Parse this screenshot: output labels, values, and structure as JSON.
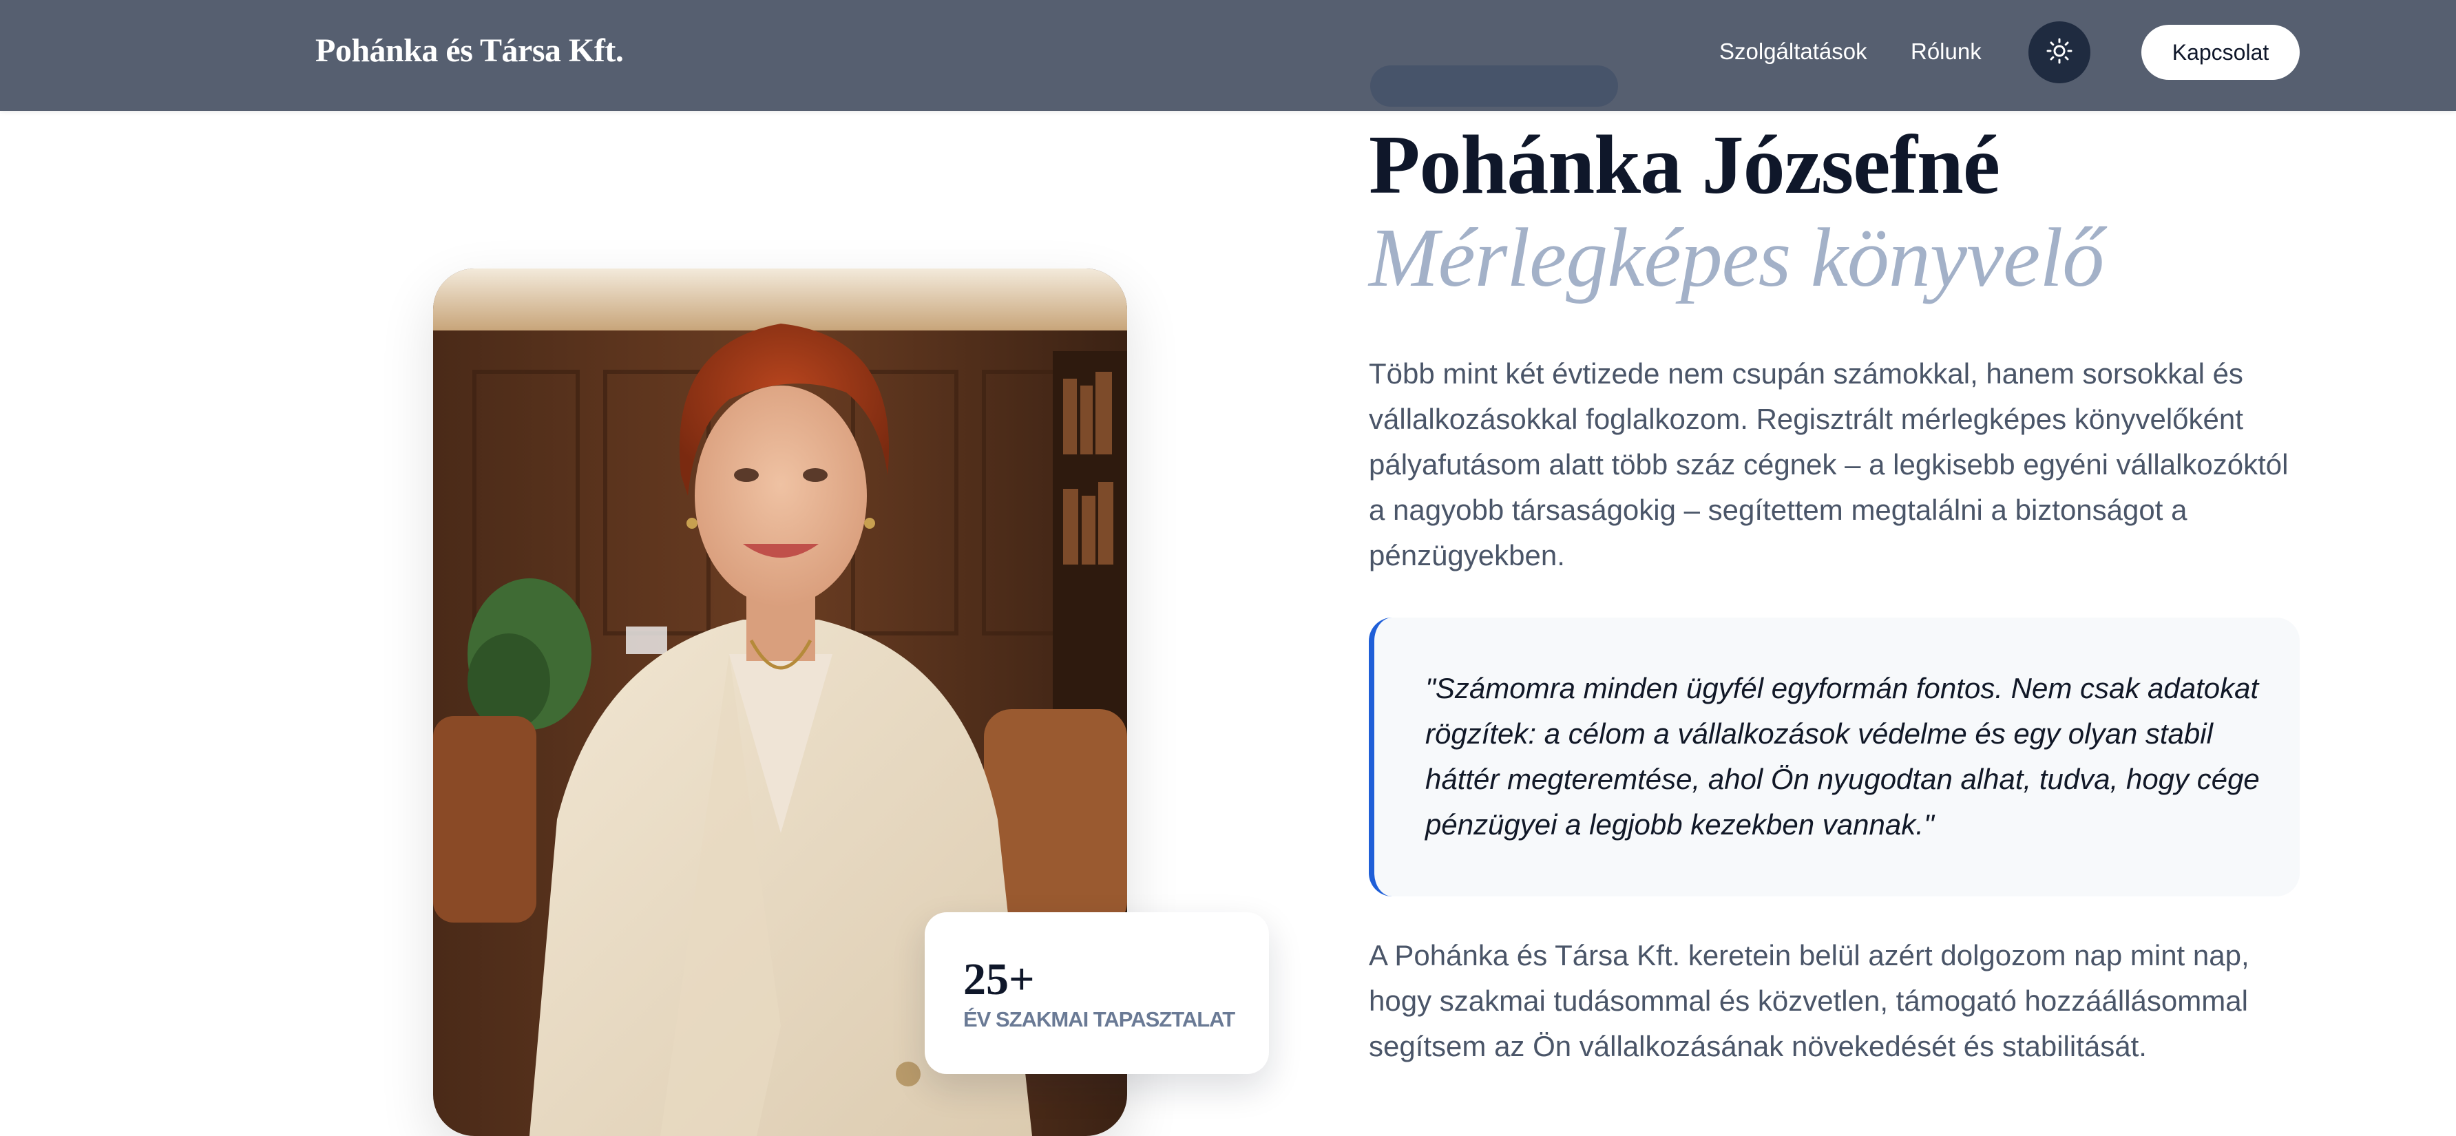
{
  "header": {
    "brand": "Pohánka és Társa Kft.",
    "nav": [
      {
        "label": "Szolgáltatások"
      },
      {
        "label": "Rólunk"
      }
    ],
    "theme_toggle_icon": "sun-icon",
    "contact_label": "Kapcsolat",
    "background_color": "#565f70"
  },
  "profile": {
    "name": "Pohánka Józsefné",
    "title": "Mérlegképes könyvelő",
    "intro": "Több mint két évtizede nem csupán számokkal, hanem sorsokkal és vállalkozásokkal foglalkozom. Regisztrált mérlegképes könyvelőként pályafutásom alatt több száz cégnek – a legkisebb egyéni vállalkozóktól a nagyobb társaságokig – segítettem megtalálni a biztonságot a pénzügyekben.",
    "quote": "\"Számomra minden ügyfél egyformán fontos. Nem csak adatokat rögzítek: a célom a vállalkozások védelme és egy olyan stabil háttér megteremtése, ahol Ön nyugodtan alhat, tudva, hogy cége pénzügyei a legjobb kezekben vannak.\"",
    "outro": "A Pohánka és Társa Kft. keretein belül azért dolgozom nap mint nap, hogy szakmai tudásommal és közvetlen, támogató hozzáállásommal segítsem az Ön vállalkozásának növekedését és stabilitását.",
    "accent_color": "#1f5fd8",
    "photo_icon": "portrait-photo"
  },
  "stat": {
    "number": "25+",
    "label": "ÉV SZAKMAI TAPASZTALAT"
  }
}
